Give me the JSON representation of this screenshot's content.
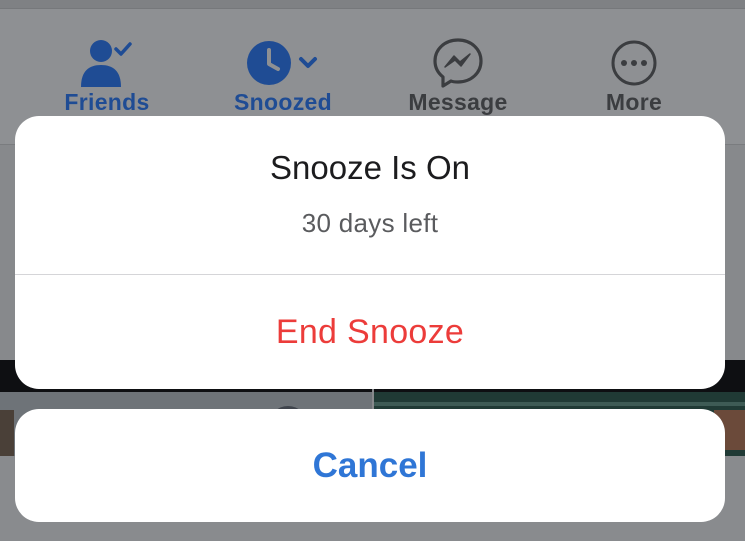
{
  "actions": [
    {
      "label": "Friends",
      "icon": "friends-check-icon",
      "color": "#1f4c94"
    },
    {
      "label": "Snoozed",
      "icon": "clock-snooze-icon",
      "color": "#1f4c94"
    },
    {
      "label": "Message",
      "icon": "messenger-icon",
      "color": "#3b3d40"
    },
    {
      "label": "More",
      "icon": "more-dots-icon",
      "color": "#3b3d40"
    }
  ],
  "sheet": {
    "title": "Snooze Is On",
    "subtitle": "30 days left",
    "end_label": "End Snooze",
    "end_color": "#ec3c3a",
    "cancel_label": "Cancel",
    "cancel_color": "#2f76d6"
  }
}
